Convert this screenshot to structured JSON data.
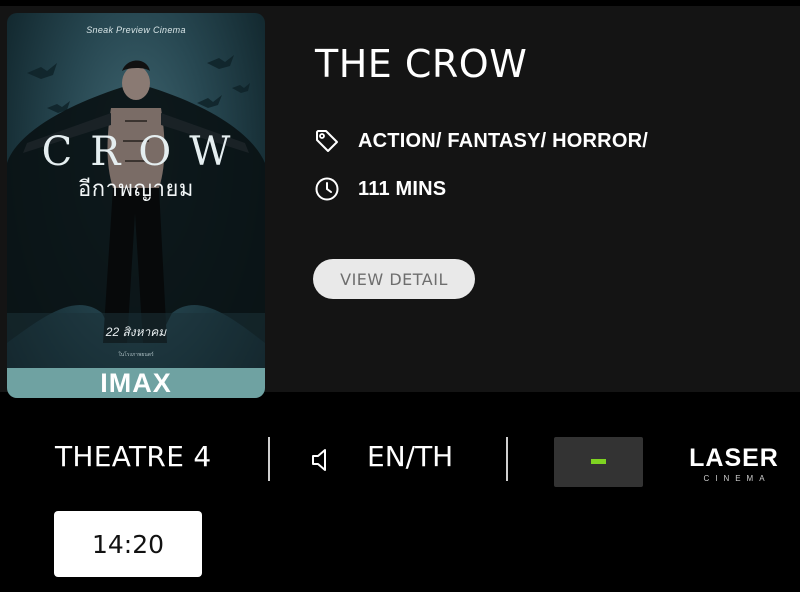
{
  "movie": {
    "title": "THE CROW",
    "genre": "ACTION/ FANTASY/ HORROR/",
    "duration": "111 MINS",
    "detail_button": "VIEW DETAIL",
    "genre_icon": "tag-icon",
    "duration_icon": "clock-icon"
  },
  "poster": {
    "top_text": "Sneak Preview Cinema",
    "title": "CROW",
    "subtitle": "อีกาพญายม",
    "date": "22 สิงหาคม",
    "fine_print": "ในโรงภาพยนตร์",
    "badge": "IMAX",
    "badge_color": "#6fa2a2"
  },
  "session": {
    "theatre": "THEATRE 4",
    "audio_icon": "speaker-icon",
    "language": "EN/TH",
    "format_logo": {
      "word": "LASER",
      "sub": "CINEMA"
    },
    "format_badge_accent": "#7ed321",
    "showtimes": [
      "14:20"
    ]
  }
}
